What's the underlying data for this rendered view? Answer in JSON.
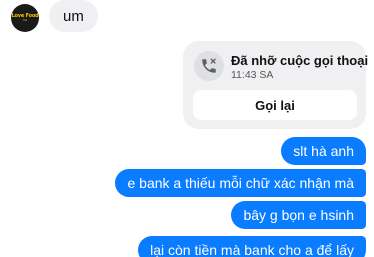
{
  "contact": {
    "avatar_text_line1": "Love Food",
    "avatar_text_line2": "Tell",
    "avatar_colors": {
      "background": "#1a1a1a",
      "logo": "#f5c400"
    }
  },
  "messages_in": [
    {
      "text": "um"
    }
  ],
  "missed_call": {
    "icon": "missed-call-phone-icon",
    "title": "Đã nhỡ cuộc gọi thoại",
    "time": "11:43 SA",
    "callback_label": "Gọi lại"
  },
  "messages_out": [
    {
      "text": "slt hà anh"
    },
    {
      "text": "e bank a thiếu mỗi chữ xác nhận mà"
    },
    {
      "text": "bây g bọn e hsinh"
    },
    {
      "text": "lại còn tiền mà bank cho a để lấy"
    }
  ],
  "colors": {
    "outgoing_bubble": "#0a7cff",
    "incoming_bubble": "#f0f0f2",
    "background": "#ffffff"
  }
}
